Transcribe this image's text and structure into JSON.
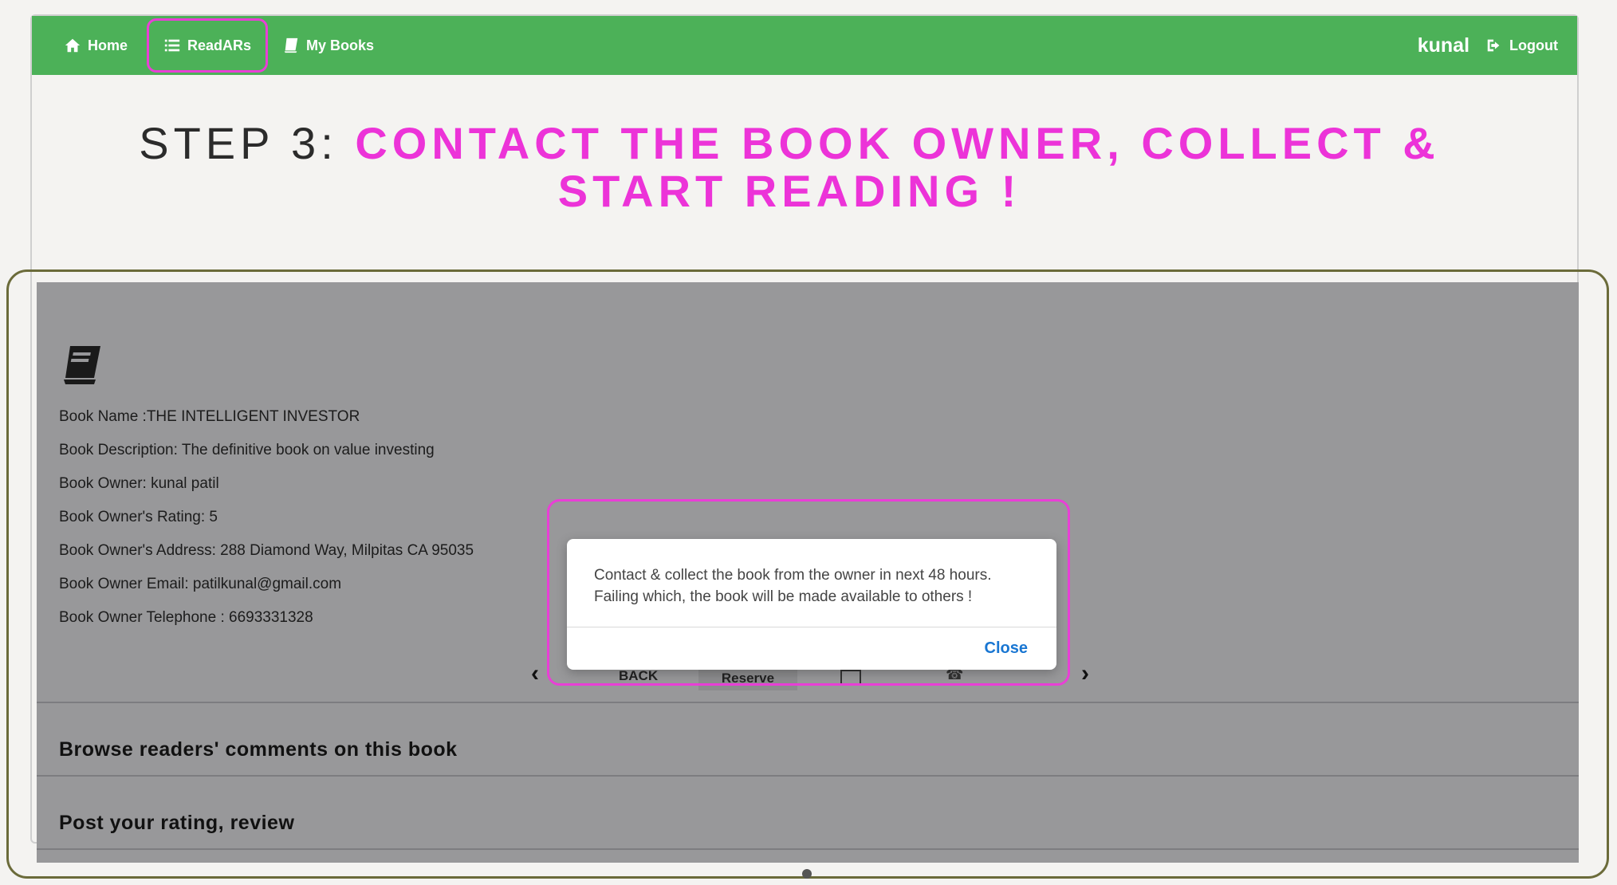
{
  "navbar": {
    "home_label": "Home",
    "readars_label": "ReadARs",
    "mybooks_label": "My Books",
    "username": "kunal",
    "logout_label": "Logout",
    "background_color": "#4cb158",
    "highlight_color": "#e93fd6"
  },
  "step": {
    "label": "STEP 3:",
    "text": "CONTACT THE BOOK OWNER, COLLECT & START READING !"
  },
  "book": {
    "icon": "book-icon",
    "name": "Book Name :THE INTELLIGENT INVESTOR",
    "description": "Book Description: The definitive book on value investing",
    "owner": "Book Owner: kunal patil",
    "owner_rating": "Book Owner's Rating: 5",
    "owner_address": "Book Owner's Address: 288 Diamond Way, Milpitas CA 95035",
    "owner_email": "Book Owner Email: patilkunal@gmail.com",
    "owner_telephone": "Book Owner Telephone : 6693331328"
  },
  "carousel": {
    "prev_icon": "chevron-left-icon",
    "next_icon": "chevron-right-icon",
    "back_label": "BACK",
    "reserve_label": "Reserve",
    "mail_icon": "mail-icon",
    "phone_icon": "phone-icon"
  },
  "sections": {
    "comments_title": "Browse readers' comments on this book",
    "rating_title": "Post your rating, review"
  },
  "modal": {
    "message_line1": "Contact & collect the book from the owner in next 48 hours.",
    "message_line2": "Failing which, the book will be made available to others !",
    "close_label": "Close"
  }
}
